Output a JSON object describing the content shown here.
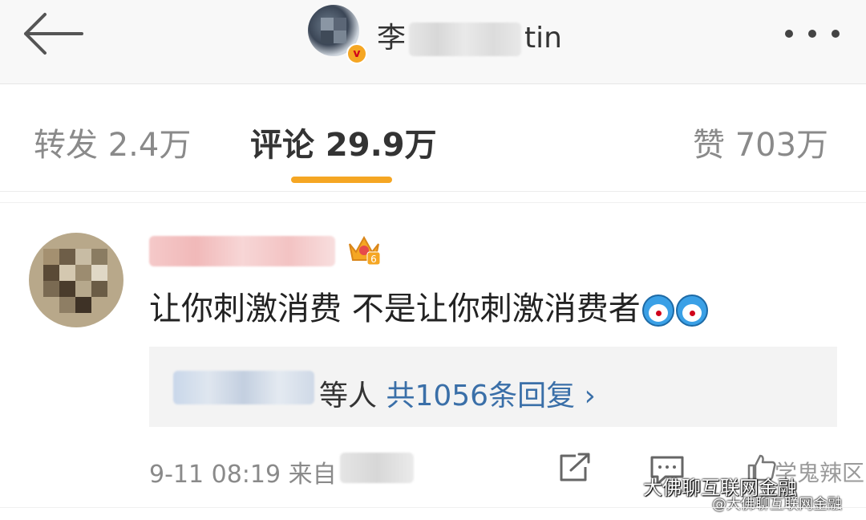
{
  "header": {
    "name_visible_start": "李",
    "name_visible_end": "tin",
    "verified_badge": "v"
  },
  "tabs": [
    {
      "label": "转发 2.4万"
    },
    {
      "label": "评论 29.9万",
      "active": true
    },
    {
      "label": "赞 703万"
    }
  ],
  "comment": {
    "text": "让你刺激消费 不是让你刺激消费者",
    "emoji_icons": [
      "doraemon-emoji",
      "doraemon-emoji"
    ],
    "reply_summary_suffix": "等人",
    "reply_count_text": "共1056条回复",
    "reply_chevron": "›",
    "time": "9-11 08:19",
    "source_prefix": "来自",
    "like_text": "学鬼辣区"
  },
  "watermark": {
    "main": "大佛聊互联网金融",
    "sub": "@大佛聊互联网金融"
  },
  "colors": {
    "accent": "#f5a623",
    "link": "#3a6fa8"
  }
}
